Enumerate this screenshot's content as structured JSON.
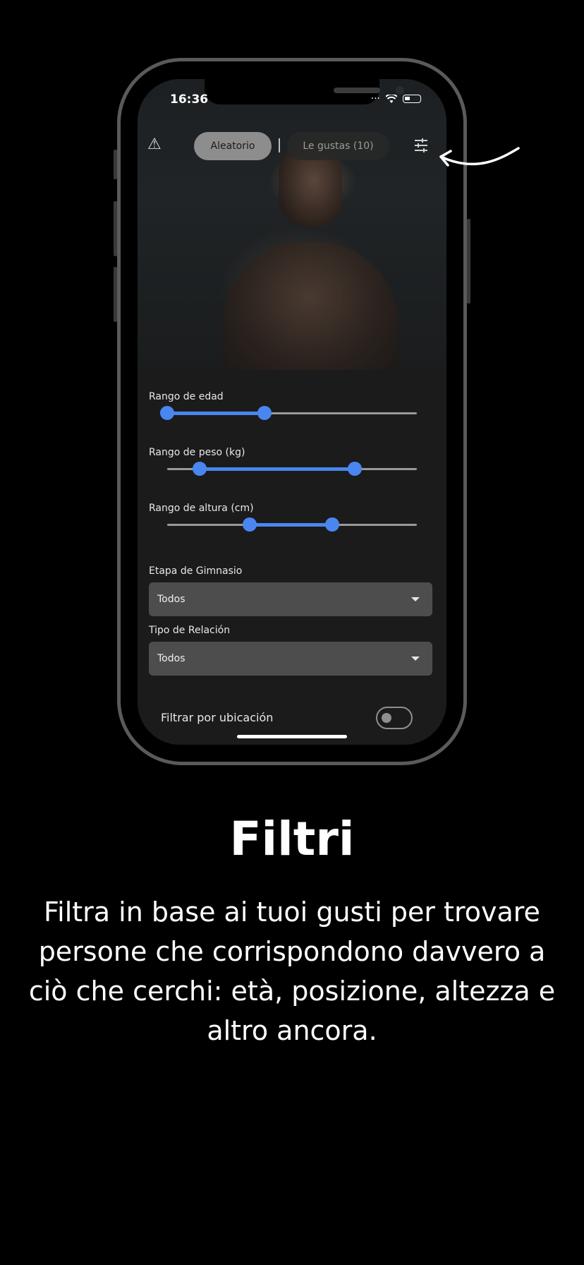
{
  "status_bar": {
    "time": "16:36",
    "signal_icon": "signal-icon",
    "wifi_icon": "wifi-icon",
    "battery_icon": "battery-icon"
  },
  "top_bar": {
    "warning_icon": "warning-icon",
    "tabs": [
      {
        "label": "Aleatorio",
        "active": true
      },
      {
        "label": "Le gustas (10)",
        "active": false
      }
    ],
    "filter_icon": "tune-icon"
  },
  "filters": {
    "age": {
      "label": "Rango de edad",
      "low": 0.0,
      "high": 0.39
    },
    "weight": {
      "label": "Rango de peso (kg)",
      "low": 0.13,
      "high": 0.75
    },
    "height": {
      "label": "Rango de altura (cm)",
      "low": 0.33,
      "high": 0.66
    },
    "gym_stage": {
      "label": "Etapa de Gimnasio",
      "value": "Todos"
    },
    "relationship": {
      "label": "Tipo de Relación",
      "value": "Todos"
    },
    "location": {
      "label": "Filtrar por ubicación",
      "enabled": false
    }
  },
  "colors": {
    "accent": "#4a86f0",
    "background": "#000000",
    "sheet": "#1b1b1b"
  },
  "feature": {
    "title": "Filtri",
    "description": "Filtra in base ai tuoi gusti per trovare persone che corrispondono davvero a ciò che cerchi: età, posizione, altezza e altro ancora."
  }
}
